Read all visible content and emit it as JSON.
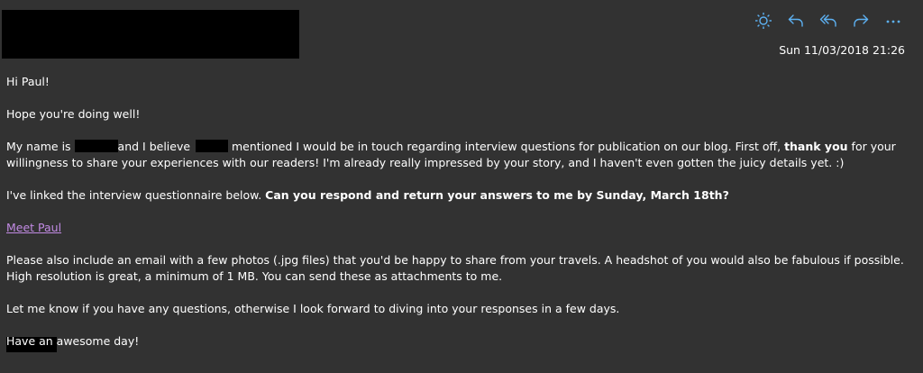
{
  "header": {
    "date": "Sun 11/03/2018 21:26",
    "toolbar": {
      "icons": [
        "sun-icon",
        "reply-icon",
        "reply-all-icon",
        "forward-icon",
        "more-icon"
      ],
      "accent": "#5db1f2"
    }
  },
  "email": {
    "greeting": "Hi Paul!",
    "line2": "Hope you're doing well!",
    "intro_part1": "My name is ",
    "intro_part2": "and I believe ",
    "intro_part3": " mentioned I would be in touch regarding interview questions for publication on our blog. First off, ",
    "intro_bold": "thank you",
    "intro_part4": " for your willingness to share your experiences with our readers! I'm already really impressed by your story, and I haven't even gotten the juicy details yet. :)",
    "questionnaire_text": "I've linked the interview questionnaire below. ",
    "questionnaire_bold": "Can you respond and return your answers to me by Sunday, March 18th?",
    "link_text": "Meet Paul",
    "photos_text": "Please also include an email with a few photos (.jpg files) that you'd be happy to share from your travels. A headshot of you would also be fabulous if possible. High resolution is great, a minimum of 1 MB. You can send these as attachments to me.",
    "closing_text": "Let me know if you have any questions, otherwise I look forward to diving into your responses in a few days.",
    "signoff": "Have an awesome day!"
  },
  "colors": {
    "background": "#323232",
    "link": "#c28be4",
    "redaction": "#000000"
  }
}
